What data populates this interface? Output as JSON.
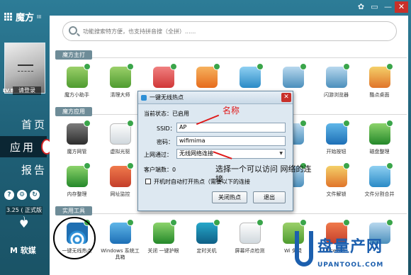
{
  "app": {
    "title": "魔方",
    "version": "III"
  },
  "window_controls": {
    "skin": "✿",
    "menu": "▭",
    "minimize": "—",
    "close": "✕"
  },
  "sidebar": {
    "level": "LV.8",
    "username": "请登录",
    "nav": [
      {
        "label": "首页",
        "active": false
      },
      {
        "label": "应用",
        "active": true
      },
      {
        "label": "报告",
        "active": false
      }
    ],
    "icons": [
      "?",
      "⚙",
      "↻"
    ],
    "date": "3.25 ( 正式版 )",
    "heart": "♥",
    "brand": "M 软媒"
  },
  "search": {
    "placeholder": "功能搜索特方便，也支持拼音搜（全拼）......"
  },
  "sections": {
    "main": "魔方主打",
    "apps": "魔方应用",
    "tools": "实用工具"
  },
  "row1": [
    {
      "label": "魔方小助手",
      "icon": "wifi-icon",
      "cls": "c1"
    },
    {
      "label": "清理大师",
      "icon": "brush-icon",
      "cls": "c1"
    },
    {
      "label": "",
      "icon": "paint-icon",
      "cls": "c3"
    },
    {
      "label": "",
      "icon": "rocket-icon",
      "cls": "c4"
    },
    {
      "label": "",
      "icon": "tools-icon",
      "cls": "c5"
    },
    {
      "label": "",
      "icon": "ie-icon",
      "cls": "c6"
    },
    {
      "label": "闪游浏览器",
      "icon": "browser-icon",
      "cls": "c6"
    },
    {
      "label": "酷点桌面",
      "icon": "cubes-icon",
      "cls": "c7"
    }
  ],
  "row2": [
    {
      "label": "魔方网管",
      "icon": "speedometer-icon",
      "cls": "c9"
    },
    {
      "label": "虚拟光驱",
      "icon": "disc-icon",
      "cls": "c12"
    },
    {
      "label": "",
      "icon": "blank",
      "cls": "c6"
    },
    {
      "label": "",
      "icon": "blank",
      "cls": "c6"
    },
    {
      "label": "",
      "icon": "blank",
      "cls": "c6"
    },
    {
      "label": "",
      "icon": "blank",
      "cls": "c6"
    },
    {
      "label": "开始按钮",
      "icon": "windows-icon",
      "cls": "c2"
    },
    {
      "label": "磁盘整理",
      "icon": "disk-icon",
      "cls": "c10"
    }
  ],
  "row3": [
    {
      "label": "内存整理",
      "icon": "memory-icon",
      "cls": "c10"
    },
    {
      "label": "网址监控",
      "icon": "monitor-icon",
      "cls": "c8"
    },
    {
      "label": "",
      "icon": "blank",
      "cls": "c6"
    },
    {
      "label": "",
      "icon": "blank",
      "cls": "c6"
    },
    {
      "label": "",
      "icon": "blank",
      "cls": "c6"
    },
    {
      "label": "",
      "icon": "blank",
      "cls": "c6"
    },
    {
      "label": "文件解锁",
      "icon": "unlock-icon",
      "cls": "c7"
    },
    {
      "label": "文件分割合并",
      "icon": "split-icon",
      "cls": "c5"
    }
  ],
  "row4": [
    {
      "label": "一键无线热点",
      "icon": "wifi-hotspot-icon",
      "cls": "wifi-ic"
    },
    {
      "label": "Windows 系统工具箱",
      "icon": "windows-toolbox-icon",
      "cls": "c2"
    },
    {
      "label": "关闭 一键护眼",
      "icon": "eye-icon",
      "cls": "c10"
    },
    {
      "label": "定时关机",
      "icon": "power-icon",
      "cls": "c11"
    },
    {
      "label": "屏幕坏点检测",
      "icon": "screen-icon",
      "cls": "c12"
    },
    {
      "label": "Wi 免费",
      "icon": "wifi-free-icon",
      "cls": "c1"
    },
    {
      "label": "fice201",
      "icon": "office-icon",
      "cls": "c8"
    },
    {
      "label": "",
      "icon": "blank",
      "cls": "c6"
    }
  ],
  "dialog": {
    "title": "一键无线热点",
    "close": "✕",
    "status_label": "当前状态：",
    "status_value": "已启用",
    "ssid_label": "SSID：",
    "ssid_value": "AP",
    "password_label": "密码：",
    "password_value": "wifimima",
    "network_label": "上网通过：",
    "network_value": "无线网络连接",
    "clients_label": "客户端数：",
    "clients_value": "0",
    "autostart_label": "开机时自动打开热点（需要以下的连接",
    "btn_close_hotspot": "关闭热点",
    "btn_exit": "退出"
  },
  "annotations": {
    "name_note": "名称",
    "network_note": "选择一个可以访问 网络的连接"
  },
  "watermark": {
    "brand": "盘量产网",
    "url": "UPANTOOL.COM",
    "label": "一键无线热点"
  }
}
